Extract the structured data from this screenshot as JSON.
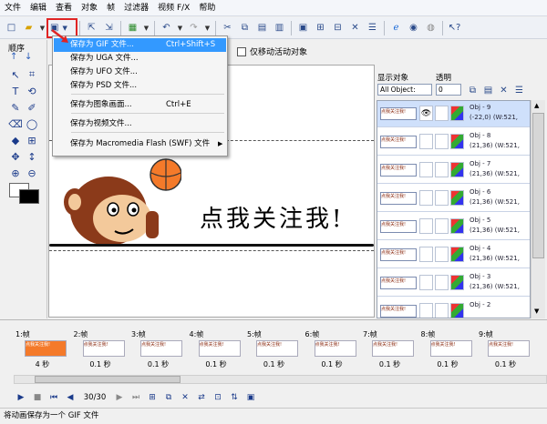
{
  "menubar": [
    "文件",
    "编辑",
    "查看",
    "对象",
    "帧",
    "过滤器",
    "视频 F/X",
    "帮助"
  ],
  "toolbar": {
    "save_icon": "save-floppy-icon",
    "highlight_color": "#e02424"
  },
  "left_panel": {
    "order_label": "顺序"
  },
  "options_bar": {
    "move_active_only": "仅移动活动对象"
  },
  "canvas": {
    "banner_text": "点我关注我!",
    "accent": "#f47a2a"
  },
  "right_panel": {
    "display_objects_label": "显示对象",
    "transparency_label": "透明",
    "filter_value": "All Object:",
    "transparency_value": "0",
    "objects": [
      {
        "name": "Obj - 9",
        "coords": "(-22,0)",
        "size": "(W:521,",
        "selected": true
      },
      {
        "name": "Obj - 8",
        "coords": "(21,36)",
        "size": "(W:521,",
        "selected": false
      },
      {
        "name": "Obj - 7",
        "coords": "(21,36)",
        "size": "(W:521,",
        "selected": false
      },
      {
        "name": "Obj - 6",
        "coords": "(21,36)",
        "size": "(W:521,",
        "selected": false
      },
      {
        "name": "Obj - 5",
        "coords": "(21,36)",
        "size": "(W:521,",
        "selected": false
      },
      {
        "name": "Obj - 4",
        "coords": "(21,36)",
        "size": "(W:521,",
        "selected": false
      },
      {
        "name": "Obj - 3",
        "coords": "(21,36)",
        "size": "(W:521,",
        "selected": false
      },
      {
        "name": "Obj - 2",
        "coords": "",
        "size": "",
        "selected": false
      }
    ]
  },
  "dropdown": {
    "items": [
      {
        "label": "保存为 GIF 文件...",
        "shortcut": "Ctrl+Shift+S",
        "active": true
      },
      {
        "label": "保存为 UGA 文件...",
        "shortcut": ""
      },
      {
        "label": "保存为 UFO 文件...",
        "shortcut": ""
      },
      {
        "label": "保存为 PSD 文件...",
        "shortcut": ""
      },
      {
        "label": "保存为图象画面...",
        "shortcut": "Ctrl+E"
      },
      {
        "label": "保存为视频文件...",
        "shortcut": ""
      },
      {
        "label": "保存为 Macromedia Flash (SWF) 文件",
        "shortcut": "",
        "submenu": true
      }
    ]
  },
  "timeline": {
    "frames": [
      {
        "label": "1:帧",
        "duration": "4 秒"
      },
      {
        "label": "2:帧",
        "duration": "0.1 秒"
      },
      {
        "label": "3:帧",
        "duration": "0.1 秒"
      },
      {
        "label": "4:帧",
        "duration": "0.1 秒"
      },
      {
        "label": "5:帧",
        "duration": "0.1 秒"
      },
      {
        "label": "6:帧",
        "duration": "0.1 秒"
      },
      {
        "label": "7:帧",
        "duration": "0.1 秒"
      },
      {
        "label": "8:帧",
        "duration": "0.1 秒"
      },
      {
        "label": "9:帧",
        "duration": "0.1 秒"
      }
    ],
    "counter": "30/30"
  },
  "status": "将动画保存为一个 GIF 文件"
}
